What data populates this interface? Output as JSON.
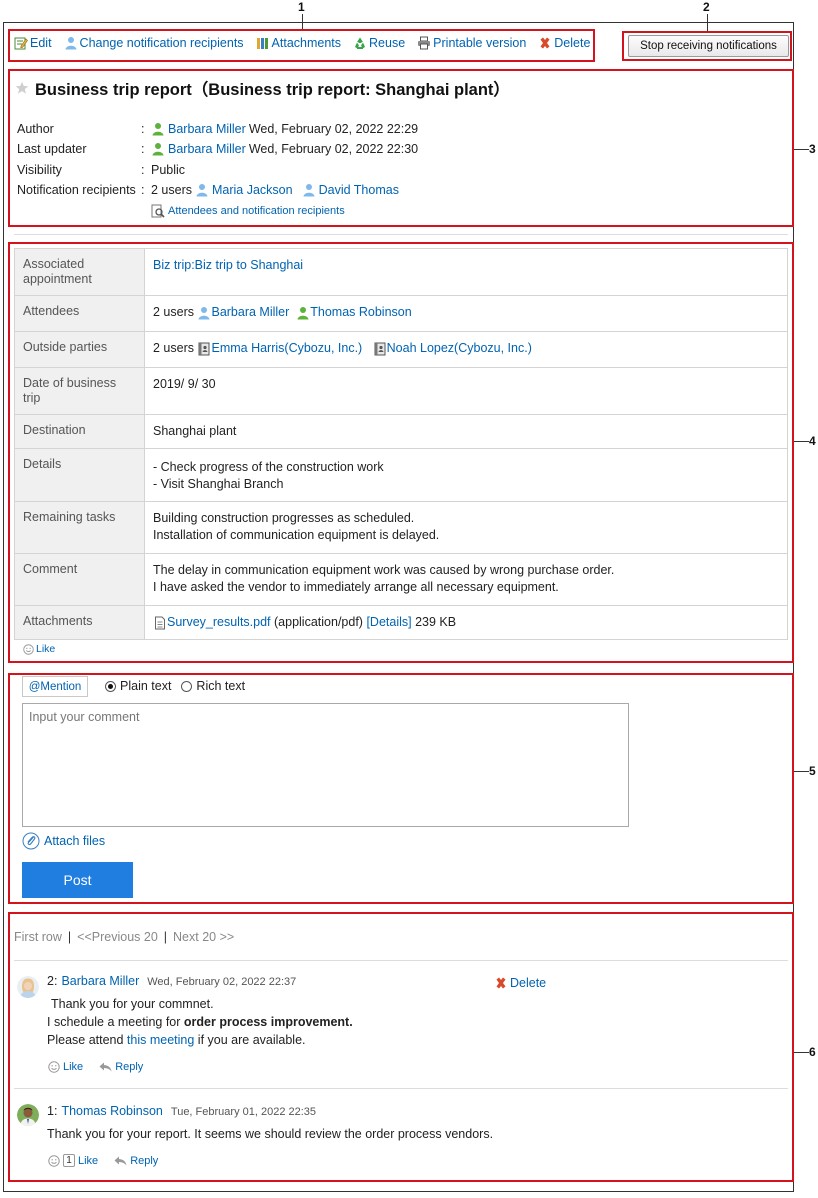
{
  "callouts": [
    "1",
    "2",
    "3",
    "4",
    "5",
    "6"
  ],
  "toolbar": {
    "edit": "Edit",
    "change_recipients": "Change notification recipients",
    "attachments": "Attachments",
    "reuse": "Reuse",
    "printable": "Printable version",
    "delete": "Delete",
    "stop_notifications": "Stop receiving notifications"
  },
  "report": {
    "title": "Business trip report（Business trip report: Shanghai plant）",
    "author_label": "Author",
    "author_name": "Barbara Miller",
    "author_date": "Wed, February 02, 2022 22:29",
    "updater_label": "Last updater",
    "updater_name": "Barbara Miller",
    "updater_date": "Wed, February 02, 2022 22:30",
    "visibility_label": "Visibility",
    "visibility_value": "Public",
    "recipients_label": "Notification recipients",
    "recipients_count": "2 users",
    "recipient_1": "Maria Jackson",
    "recipient_2": "David Thomas",
    "attendees_link": "Attendees and notification recipients",
    "colon": ":"
  },
  "details": {
    "associated_label": "Associated appointment",
    "associated_value": "Biz trip:Biz trip to Shanghai",
    "attendees_label": "Attendees",
    "attendees_count": "2 users",
    "attendee_1": "Barbara Miller",
    "attendee_2": "Thomas Robinson",
    "outside_label": "Outside parties",
    "outside_count": "2 users",
    "outside_1": "Emma Harris(Cybozu, Inc.)",
    "outside_2": "Noah Lopez(Cybozu, Inc.)",
    "date_label": "Date of business trip",
    "date_value": "2019/ 9/ 30",
    "destination_label": "Destination",
    "destination_value": "Shanghai plant",
    "details_label": "Details",
    "details_line_1": "- Check progress of the construction work",
    "details_line_2": "- Visit Shanghai Branch",
    "remaining_label": "Remaining tasks",
    "remaining_line_1": "Building construction progresses as scheduled.",
    "remaining_line_2": "Installation of communication equipment is delayed.",
    "comment_label": "Comment",
    "comment_line_1": "The delay in communication equipment work was caused by wrong purchase order.",
    "comment_line_2": "I have asked the vendor to immediately arrange all necessary equipment.",
    "attachments_label": "Attachments",
    "attachment_file": "Survey_results.pdf",
    "attachment_type": "(application/pdf)",
    "attachment_details": "[Details]",
    "attachment_size": "239 KB",
    "like": "Like"
  },
  "form": {
    "mention": "@Mention",
    "plain_text": "Plain text",
    "rich_text": "Rich text",
    "placeholder": "Input your comment",
    "attach_files": "Attach files",
    "post": "Post"
  },
  "pager": {
    "first": "First row",
    "sep": "|",
    "previous": "<<Previous 20",
    "next": "Next 20 >>"
  },
  "comments": [
    {
      "number": "2:",
      "author": "Barbara Miller",
      "date": "Wed, February 02, 2022 22:37",
      "line_1": "Thank you for your commnet.",
      "line_2_prefix": "I schedule a meeting for ",
      "line_2_bold": "order process improvement.",
      "line_3_prefix": "Please attend ",
      "line_3_link": "this meeting",
      "line_3_suffix": " if you are available.",
      "like": "Like",
      "reply": "Reply",
      "delete": "Delete"
    },
    {
      "number": "1:",
      "author": "Thomas Robinson",
      "date": "Tue, February 01, 2022 22:35",
      "line_1": "Thank you for your report. It seems we should review the order process vendors.",
      "like_count": "1",
      "like": "Like",
      "reply": "Reply"
    }
  ],
  "colors": {
    "accent_red": "#d4141c",
    "link_blue": "#0063b1",
    "post_button": "#1f7ee0"
  }
}
